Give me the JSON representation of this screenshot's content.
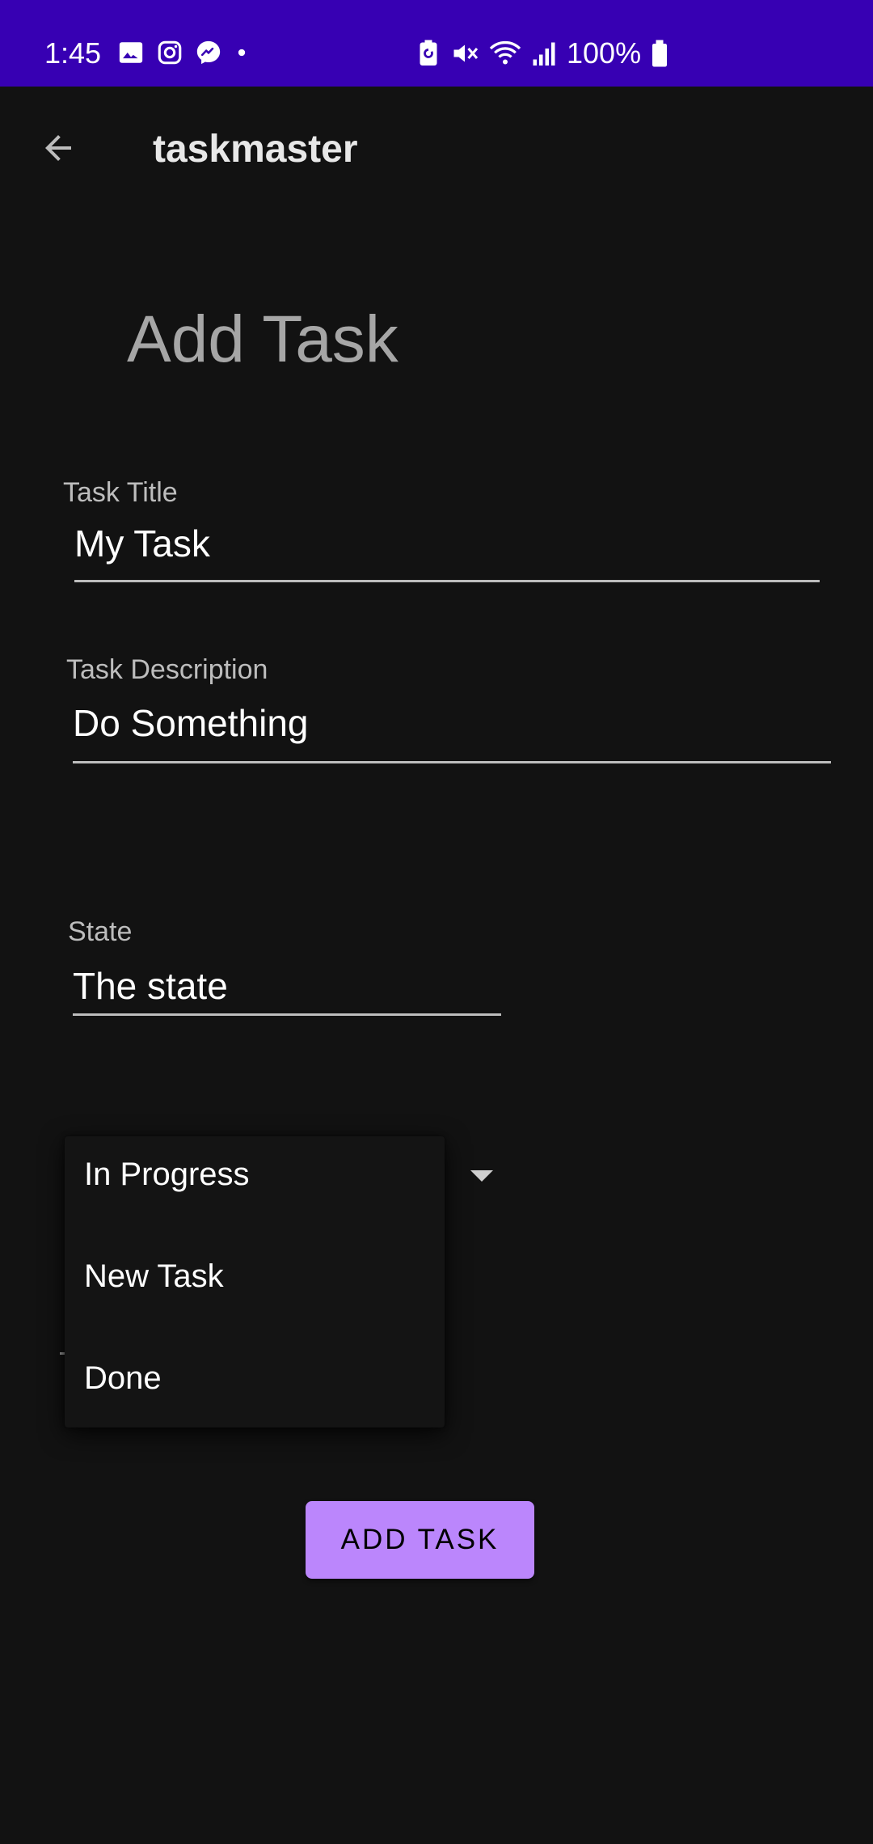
{
  "status_bar": {
    "time": "1:45",
    "battery": "100%",
    "left_icons": [
      "gallery-icon",
      "instagram-icon",
      "messenger-icon",
      "dot-icon"
    ],
    "right_icons": [
      "battery-saver-icon",
      "mute-icon",
      "wifi-icon",
      "signal-icon",
      "battery-icon"
    ],
    "background": "#3700b3"
  },
  "app_bar": {
    "title": "taskmaster",
    "back_icon": "arrow-back-icon"
  },
  "page": {
    "title": "Add Task"
  },
  "form": {
    "task_title": {
      "label": "Task Title",
      "value": "My Task"
    },
    "task_description": {
      "label": "Task Description",
      "value": "Do Something"
    },
    "state": {
      "label": "State",
      "value": "The state"
    }
  },
  "dropdown": {
    "options": [
      "In Progress",
      "New Task",
      "Done"
    ],
    "arrow_icon": "dropdown-arrow-icon"
  },
  "actions": {
    "add_task_label": "ADD TASK",
    "accent": "#bb86fc"
  }
}
